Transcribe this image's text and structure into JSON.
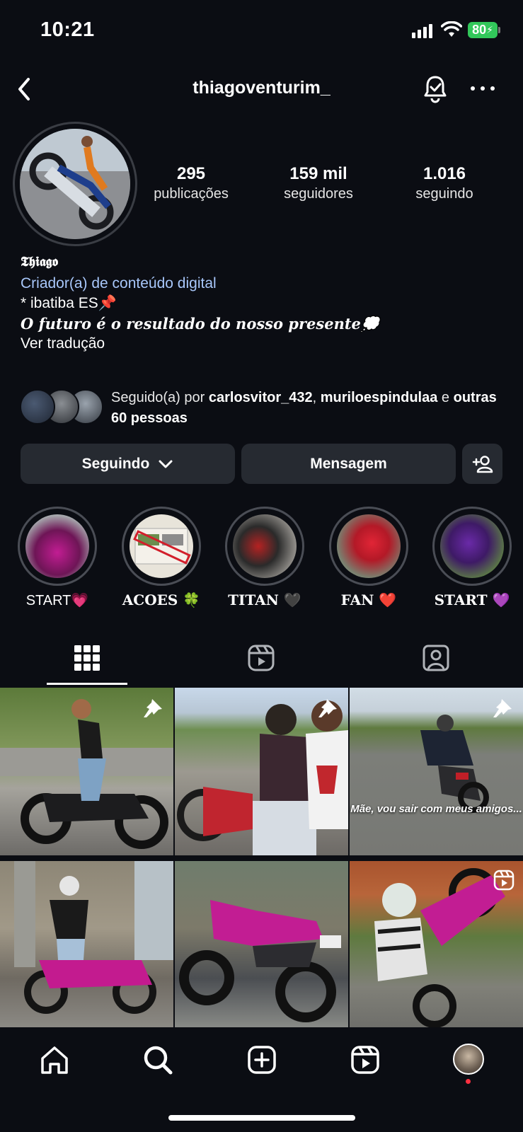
{
  "status_bar": {
    "time": "10:21",
    "battery": "80"
  },
  "header": {
    "username": "thiagoventurim_"
  },
  "stats": [
    {
      "value": "295",
      "label": "publicações"
    },
    {
      "value": "159 mil",
      "label": "seguidores"
    },
    {
      "value": "1.016",
      "label": "seguindo"
    }
  ],
  "bio": {
    "name": "𝕿𝖍𝖎𝖆𝖌𝖔 ",
    "category": "Criador(a) de conteúdo digital",
    "location": "* ibatiba ES📌",
    "quote": "O futuro é o resultado do nosso presente💭",
    "translate": "Ver tradução"
  },
  "followed_by": {
    "prefix": "Seguido(a) por ",
    "user1": "carlosvitor_432",
    "sep": ", ",
    "user2": "muriloespindulaa",
    "and": " e ",
    "others": "outras 60 pessoas"
  },
  "buttons": {
    "following": "Seguindo",
    "message": "Mensagem"
  },
  "highlights": [
    {
      "label": "START💗",
      "color": "#c21d93"
    },
    {
      "label": "ACOES 🍀",
      "color": "#d9d4c8"
    },
    {
      "label": "TITAN 🖤",
      "color": "#2a2a2a"
    },
    {
      "label": "FAN ❤️",
      "color": "#d41e2e"
    },
    {
      "label": "START 💜",
      "color": "#6a2aa8"
    }
  ],
  "posts": [
    {
      "pinned": true,
      "caption": ""
    },
    {
      "pinned": true,
      "caption": ""
    },
    {
      "pinned": true,
      "caption": "Mãe, vou sair com meus amigos..."
    },
    {
      "pinned": false,
      "caption": ""
    },
    {
      "pinned": false,
      "caption": ""
    },
    {
      "pinned": false,
      "caption": "",
      "reel": true
    }
  ],
  "icons": {
    "back": "chevron-left-icon",
    "bell": "notification-bell-icon",
    "more": "more-dots-icon",
    "grid": "grid-icon",
    "reels": "reels-icon",
    "tagged": "tagged-icon",
    "home": "home-icon",
    "search": "search-icon",
    "create": "create-icon",
    "reels_nav": "reels-nav-icon"
  },
  "colors": {
    "background": "#0b0d13",
    "button": "#262a31",
    "link": "#a8c7fa",
    "battery": "#32c75a"
  }
}
